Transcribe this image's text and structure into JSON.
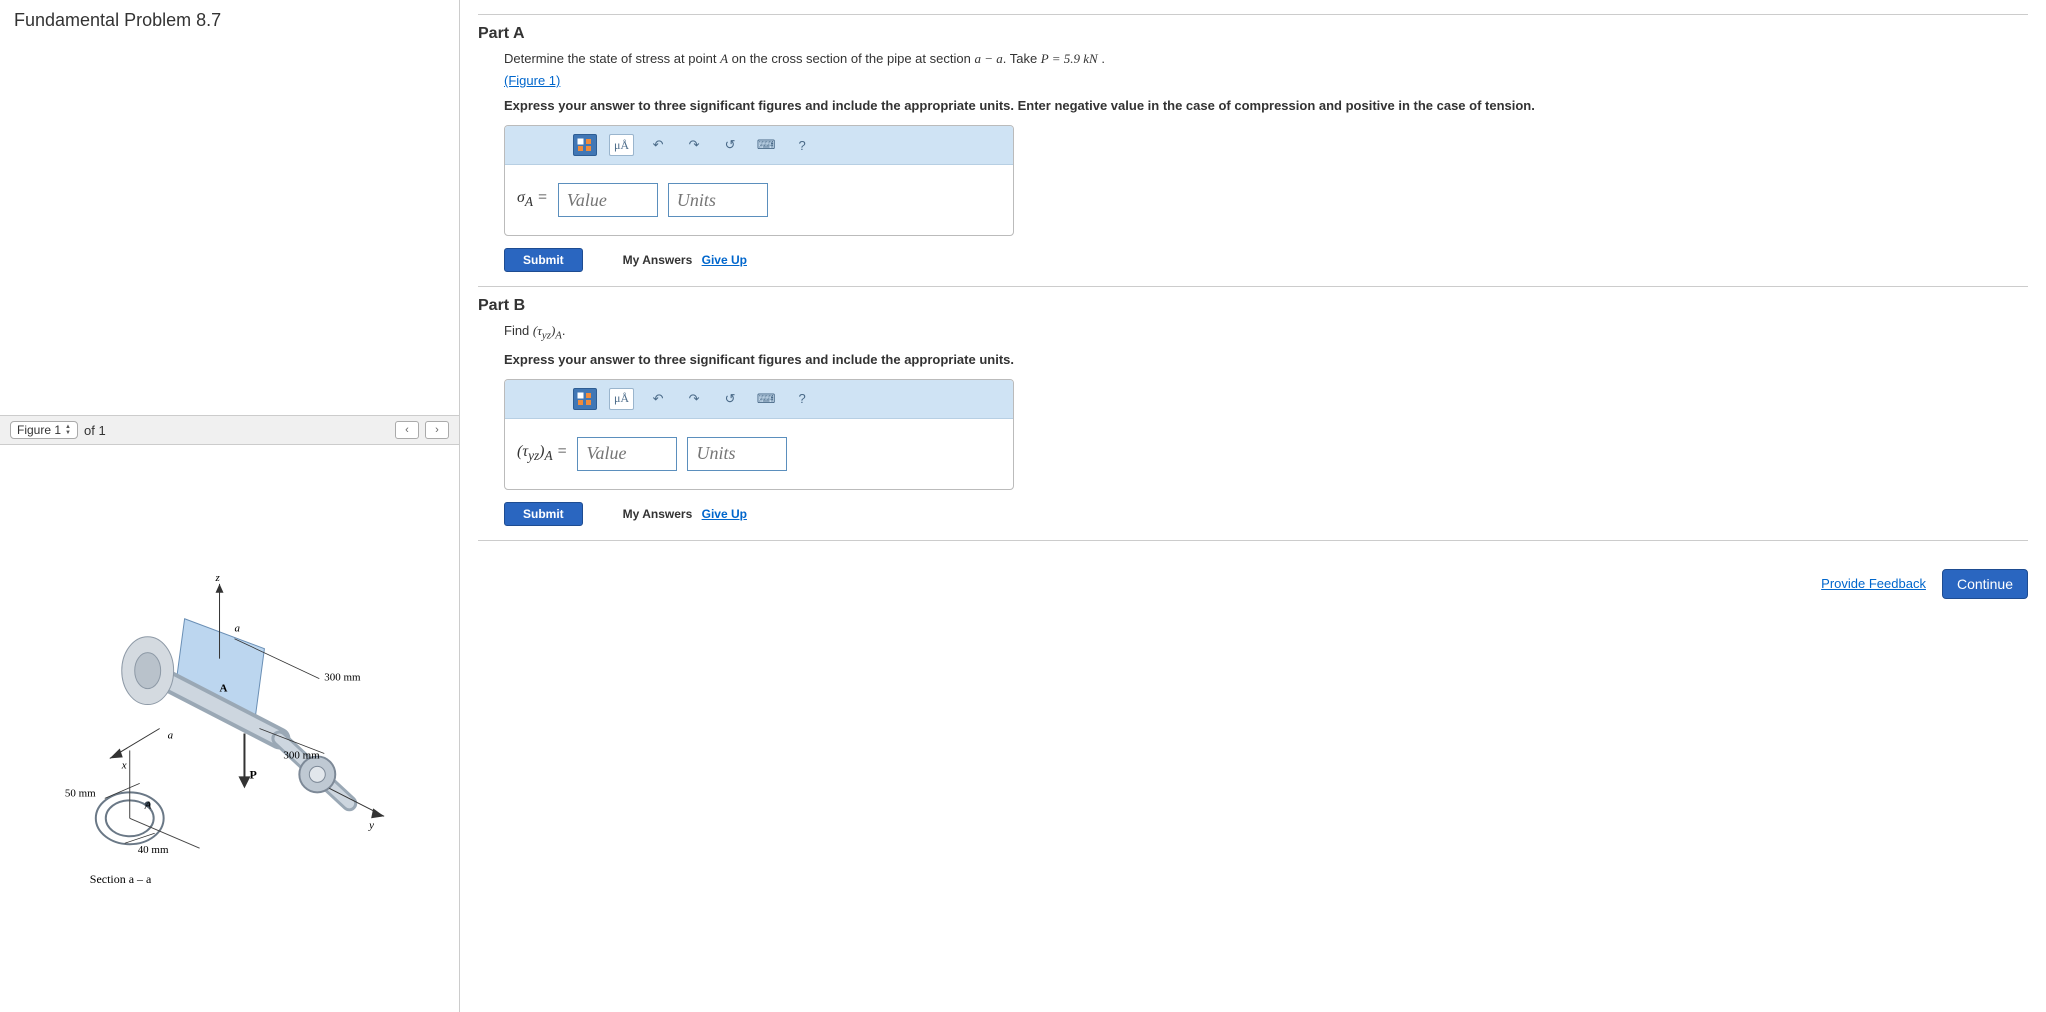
{
  "problem_title": "Fundamental Problem 8.7",
  "figure_bar": {
    "select": "Figure 1",
    "of_text": "of 1"
  },
  "figure": {
    "z": "z",
    "x": "x",
    "y": "y",
    "a1": "a",
    "a2": "a",
    "pointA": "A",
    "P": "P",
    "d1": "300 mm",
    "d2": "300 mm",
    "r_outer": "50 mm",
    "r_inner": "40 mm",
    "section_label": "Section a – a"
  },
  "parts": {
    "A": {
      "heading": "Part A",
      "prompt_prefix": "Determine the state of stress at point ",
      "pointA": "A",
      "prompt_mid": " on the cross section of the pipe at section ",
      "aa": "a − a",
      "take": ". Take ",
      "Peq": "P = 5.9  kN",
      "period": " .",
      "figure_link": "(Figure 1)",
      "instruction": "Express your answer to three significant figures and include the appropriate units. Enter negative value in the case of compression and positive in the case of tension.",
      "sigma_label": "σ",
      "sigma_sub": "A",
      "eq": " = ",
      "value_ph": "Value",
      "units_ph": "Units",
      "submit": "Submit",
      "my_answers": "My Answers",
      "give_up": "Give Up",
      "tool_units": "μÅ"
    },
    "B": {
      "heading": "Part B",
      "find_prefix": "Find ",
      "tau_expr": "(τyz)A",
      "period": ".",
      "instruction": "Express your answer to three significant figures and include the appropriate units.",
      "tau_label": "(τyz)A",
      "eq": " = ",
      "value_ph": "Value",
      "units_ph": "Units",
      "submit": "Submit",
      "my_answers": "My Answers",
      "give_up": "Give Up",
      "tool_units": "μÅ"
    }
  },
  "footer": {
    "feedback": "Provide Feedback",
    "continue": "Continue"
  }
}
